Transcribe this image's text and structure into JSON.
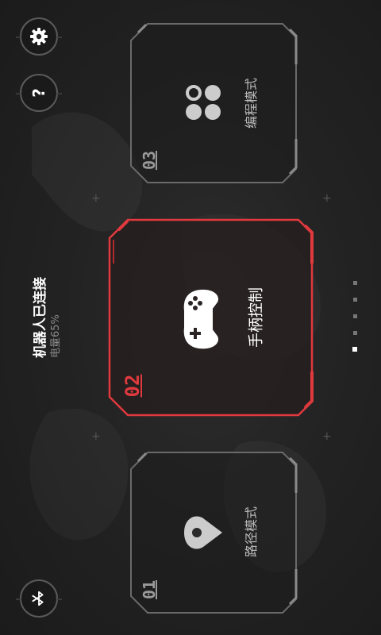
{
  "status": {
    "connection": "机器人已连接",
    "battery": "电量65%"
  },
  "buttons": {
    "settings_icon": "gear-icon",
    "help_icon": "question-icon",
    "help_glyph": "?",
    "bluetooth_icon": "bluetooth-icon"
  },
  "modes": [
    {
      "number": "01",
      "label": "路径模式",
      "icon": "location-pin-icon",
      "active": false
    },
    {
      "number": "02",
      "label": "手柄控制",
      "icon": "gamepad-icon",
      "active": true
    },
    {
      "number": "03",
      "label": "编程模式",
      "icon": "blocks-icon",
      "active": false
    }
  ],
  "pager": {
    "count": 5,
    "active_index": 0
  },
  "colors": {
    "accent": "#e0393e",
    "frame": "#6a6a6a",
    "text_muted": "#8a8a8a"
  }
}
